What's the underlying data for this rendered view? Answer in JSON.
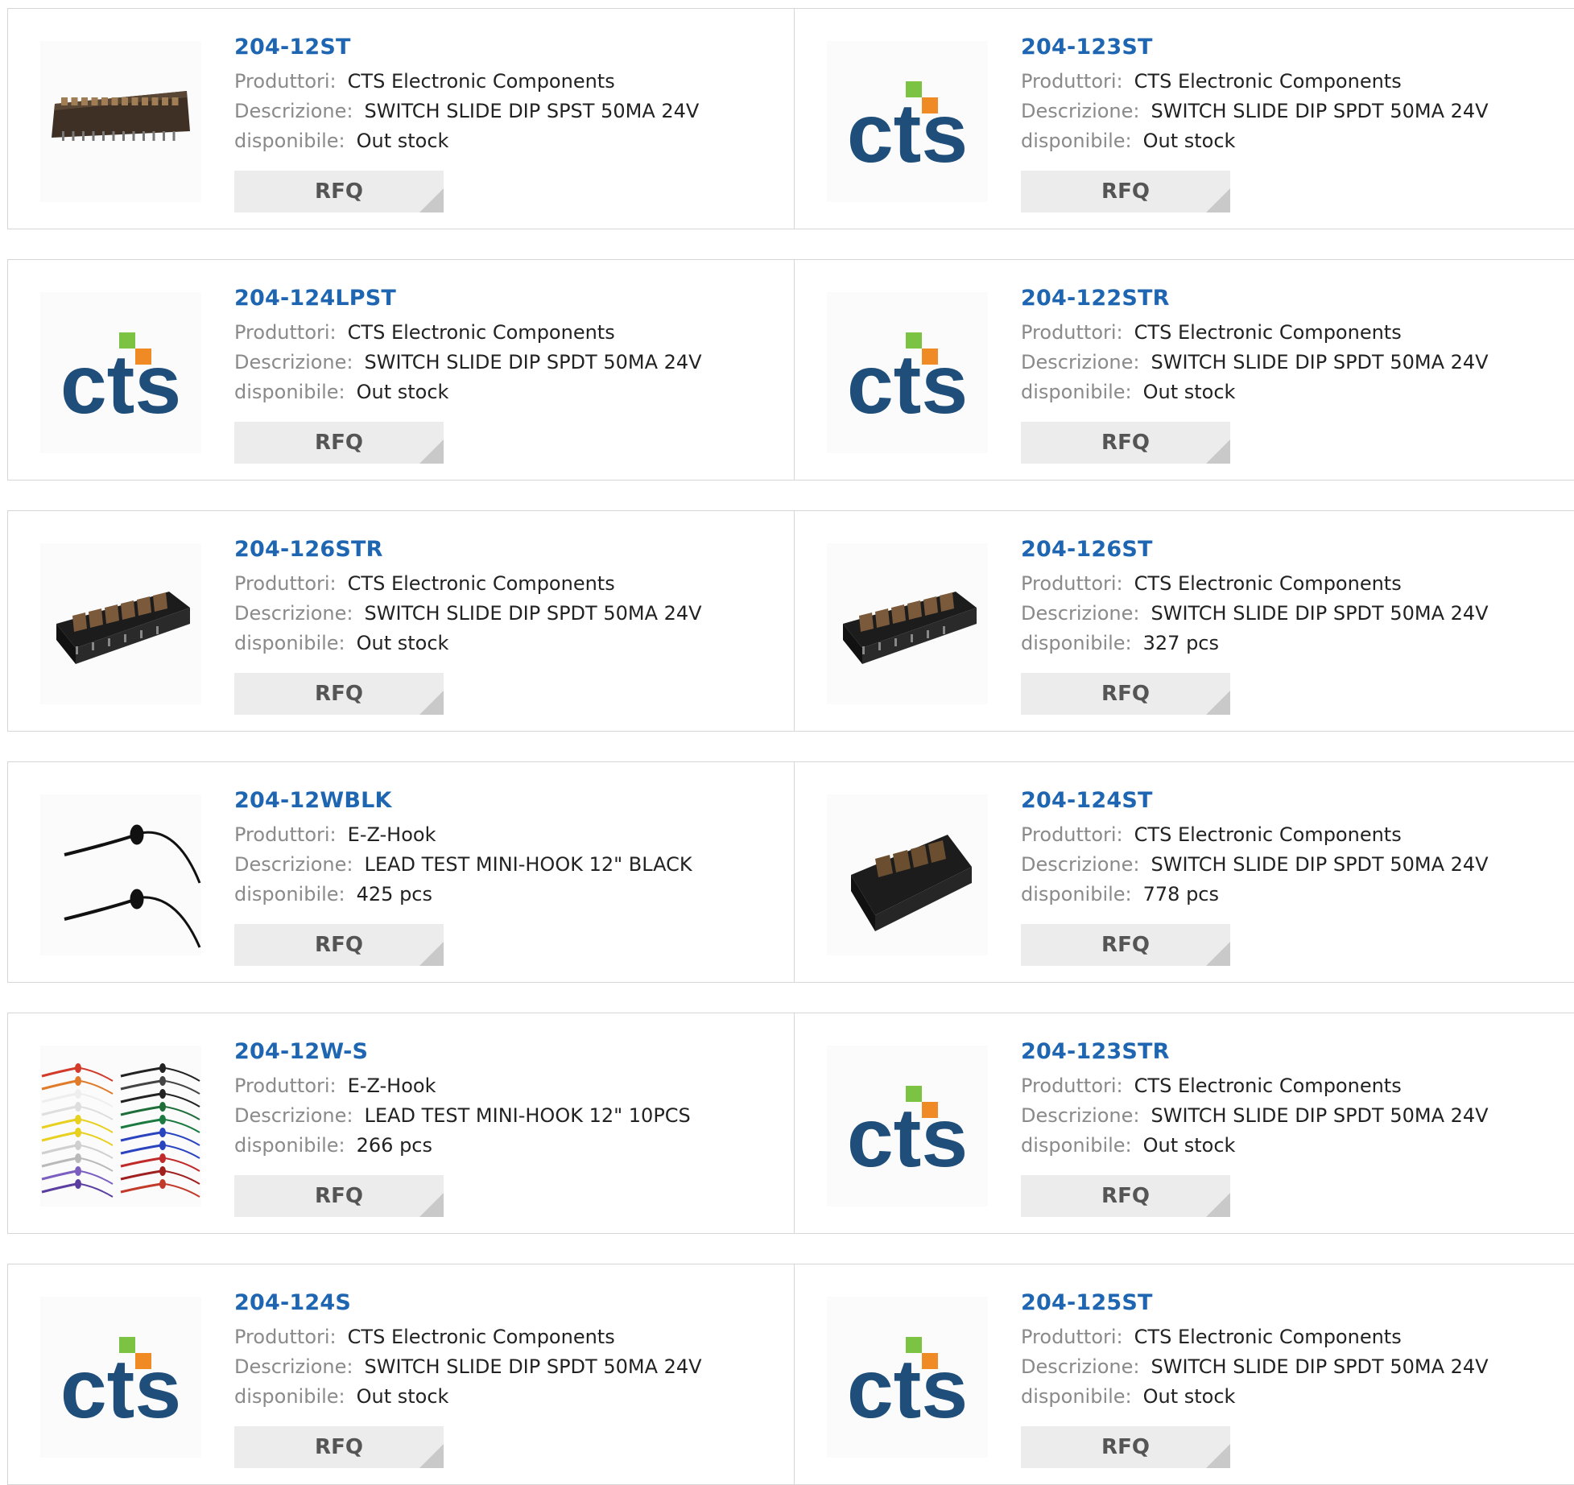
{
  "labels": {
    "manufacturer": "Produttori:",
    "description": "Descrizione:",
    "availability": "disponibile:"
  },
  "rfq_label": "RFQ",
  "brand_colors": {
    "part_link": "#1f66b2",
    "cts_blue": "#1f4e7a",
    "cts_green": "#7cc243",
    "cts_orange": "#f08a24"
  },
  "products": [
    {
      "part": "204-12ST",
      "manufacturer": "CTS Electronic Components",
      "description": "SWITCH SLIDE DIP SPST 50MA 24V",
      "availability": "Out stock",
      "image": "dip-switch-long-icon"
    },
    {
      "part": "204-123ST",
      "manufacturer": "CTS Electronic Components",
      "description": "SWITCH SLIDE DIP SPDT 50MA 24V",
      "availability": "Out stock",
      "image": "cts-logo"
    },
    {
      "part": "204-124LPST",
      "manufacturer": "CTS Electronic Components",
      "description": "SWITCH SLIDE DIP SPDT 50MA 24V",
      "availability": "Out stock",
      "image": "cts-logo"
    },
    {
      "part": "204-122STR",
      "manufacturer": "CTS Electronic Components",
      "description": "SWITCH SLIDE DIP SPDT 50MA 24V",
      "availability": "Out stock",
      "image": "cts-logo"
    },
    {
      "part": "204-126STR",
      "manufacturer": "CTS Electronic Components",
      "description": "SWITCH SLIDE DIP SPDT 50MA 24V",
      "availability": "Out stock",
      "image": "dip-switch-6-icon"
    },
    {
      "part": "204-126ST",
      "manufacturer": "CTS Electronic Components",
      "description": "SWITCH SLIDE DIP SPDT 50MA 24V",
      "availability": "327 pcs",
      "image": "dip-switch-6-icon"
    },
    {
      "part": "204-12WBLK",
      "manufacturer": "E-Z-Hook",
      "description": "LEAD TEST MINI-HOOK 12\" BLACK",
      "availability": "425 pcs",
      "image": "test-hook-black-icon"
    },
    {
      "part": "204-124ST",
      "manufacturer": "CTS Electronic Components",
      "description": "SWITCH SLIDE DIP SPDT 50MA 24V",
      "availability": "778 pcs",
      "image": "dip-switch-4-icon"
    },
    {
      "part": "204-12W-S",
      "manufacturer": "E-Z-Hook",
      "description": "LEAD TEST MINI-HOOK 12\" 10PCS",
      "availability": "266 pcs",
      "image": "test-hook-set-icon"
    },
    {
      "part": "204-123STR",
      "manufacturer": "CTS Electronic Components",
      "description": "SWITCH SLIDE DIP SPDT 50MA 24V",
      "availability": "Out stock",
      "image": "cts-logo"
    },
    {
      "part": "204-124S",
      "manufacturer": "CTS Electronic Components",
      "description": "SWITCH SLIDE DIP SPDT 50MA 24V",
      "availability": "Out stock",
      "image": "cts-logo"
    },
    {
      "part": "204-125ST",
      "manufacturer": "CTS Electronic Components",
      "description": "SWITCH SLIDE DIP SPDT 50MA 24V",
      "availability": "Out stock",
      "image": "cts-logo"
    }
  ]
}
